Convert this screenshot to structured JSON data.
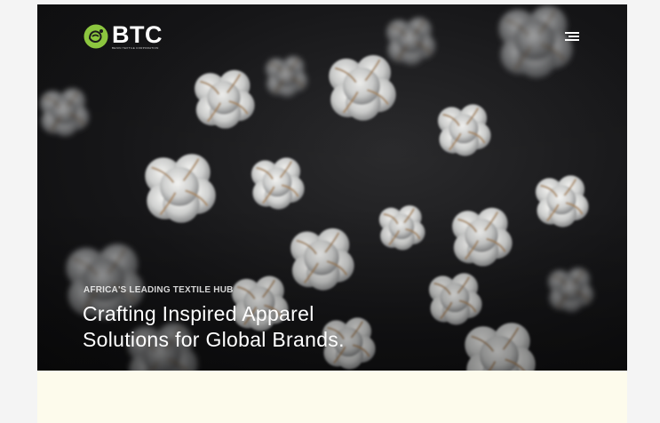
{
  "brand": {
    "name": "BTC",
    "tagline": "BENIN TEXTILE CORPORATION",
    "accent_color": "#8cc63f"
  },
  "nav": {
    "menu_icon": "hamburger-menu-icon"
  },
  "hero": {
    "eyebrow": "AFRICA'S LEADING TEXTILE HUB",
    "headline_line1": "Crafting Inspired Apparel",
    "headline_line2": "Solutions for Global Brands.",
    "background": "cotton-bolls-photo"
  },
  "colors": {
    "hero_bg": "#161618",
    "cream_section": "#fdfbec",
    "page_bg": "#f4f4f4"
  }
}
